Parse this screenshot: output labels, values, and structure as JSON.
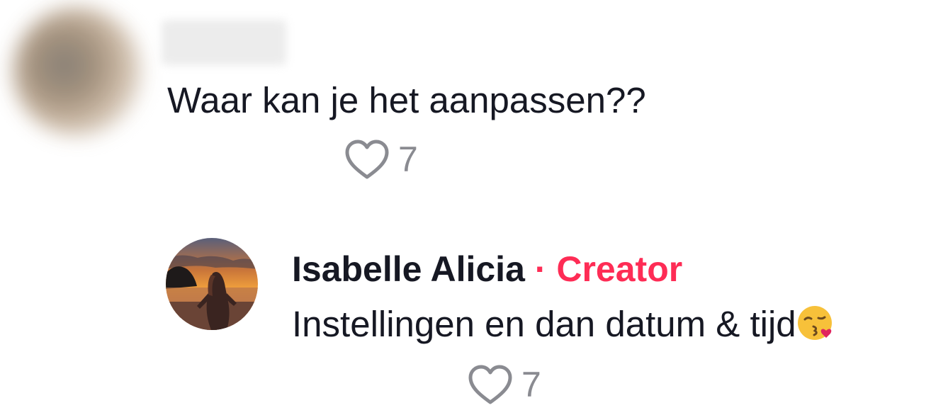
{
  "comments": [
    {
      "text": "Waar kan je het aanpassen??",
      "likes": "7"
    }
  ],
  "reply": {
    "author": "Isabelle Alicia",
    "separator": "·",
    "badge": "Creator",
    "text": "Instellingen en dan datum & tijd",
    "emoji": "kissing-face-with-heart-icon",
    "likes": "7"
  },
  "colors": {
    "badge": "#fe2c55",
    "text": "#161823",
    "muted": "#8a8b91"
  },
  "icons": {
    "like": "heart-outline-icon"
  }
}
